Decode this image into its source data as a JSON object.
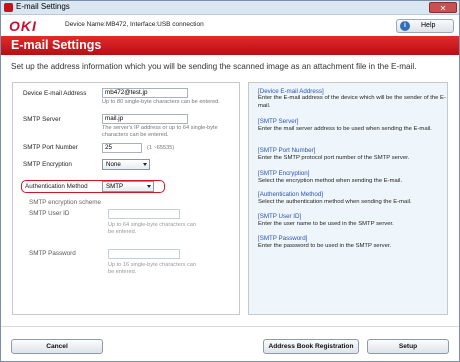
{
  "window": {
    "title": "E-mail Settings",
    "close_label": "✕"
  },
  "topbar": {
    "logo": "OKI",
    "device_info": "Device Name:MB472, Interface:USB connection",
    "help_label": "Help"
  },
  "header": {
    "title": "E-mail Settings"
  },
  "instruction": "Set up the address information which you will be sending the scanned image as an attachment file in the E-mail.",
  "form": {
    "device_email": {
      "label": "Device E-mail Address",
      "value": "mb472@test.jp",
      "hint": "Up to 80 single-byte characters can be entered."
    },
    "smtp_server": {
      "label": "SMTP Server",
      "value": "mail.jp",
      "hint_line1": "The server's IP address or up to 64 single-byte",
      "hint_line2": "characters can be entered."
    },
    "smtp_port": {
      "label": "SMTP Port Number",
      "value": "25",
      "range": "(1 ~65535)"
    },
    "smtp_encryption": {
      "label": "SMTP Encryption",
      "value": "None"
    },
    "auth_method": {
      "label": "Authentication Method",
      "value": "SMTP"
    },
    "smtp_scheme": {
      "label": "SMTP encryption scheme"
    },
    "smtp_user_id": {
      "label": "SMTP User ID",
      "value": "",
      "hint_line1": "Up to 64 single-byte characters can",
      "hint_line2": "be entered."
    },
    "smtp_password": {
      "label": "SMTP Password",
      "value": "",
      "hint_line1": "Up to 16 single-byte characters can",
      "hint_line2": "be entered."
    }
  },
  "descriptions": [
    {
      "head": "[Device E-mail Address]",
      "body": "Enter the E-mail address of the device which will be the sender of the E-mail."
    },
    {
      "head": "[SMTP Server]",
      "body": "Enter the mail server address to be used when sending the E-mail."
    },
    {
      "head": "[SMTP Port Number]",
      "body": "Enter the SMTP protocol port number of the SMTP server."
    },
    {
      "head": "[SMTP Encryption]",
      "body": "Select the encryption method when sending the E-mail."
    },
    {
      "head": "[Authentication Method]",
      "body": "Select the authentication method when sending the E-mail."
    },
    {
      "head": "[SMTP User ID]",
      "body": "Enter the user name to be used in the SMTP server."
    },
    {
      "head": "[SMTP Password]",
      "body": "Enter the password to be used in the SMTP server."
    }
  ],
  "buttons": {
    "cancel": "Cancel",
    "address_book": "Address Book Registration",
    "setup": "Setup"
  },
  "colors": {
    "brand_red": "#c8102e",
    "link_blue": "#2b53b8",
    "panel_bg": "#eef6fb"
  }
}
